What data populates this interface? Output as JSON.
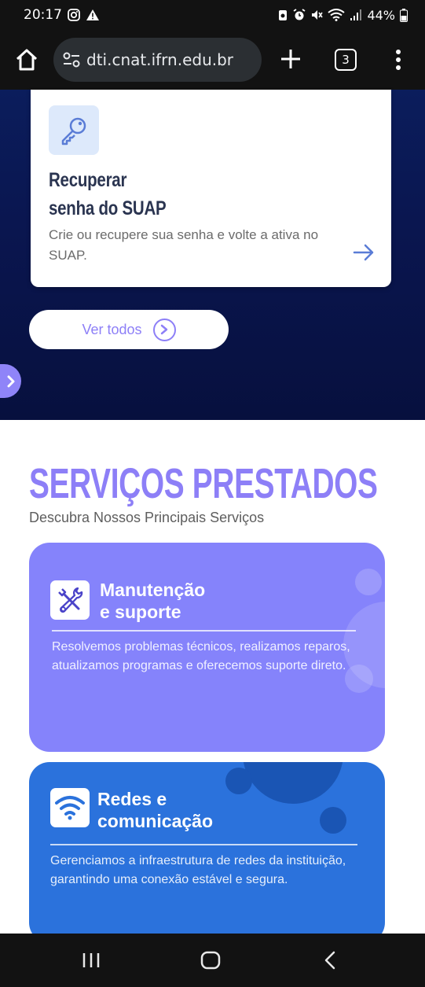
{
  "status": {
    "time": "20:17",
    "battery": "44%"
  },
  "browser": {
    "url": "dti.cnat.ifrn.edu.br",
    "tab_count": "3"
  },
  "recover_card": {
    "title_line1": "Recuperar",
    "title_line2": "senha do SUAP",
    "description": "Crie ou recupere sua senha e volte a ativa no SUAP."
  },
  "see_all_label": "Ver todos",
  "services": {
    "title": "SERVIÇOS PRESTADOS",
    "subtitle": "Descubra Nossos Principais Serviços",
    "items": [
      {
        "title_line1": "Manutenção",
        "title_line2": "e suporte",
        "description": "Resolvemos problemas técnicos, realizamos reparos, atualizamos programas e oferecemos suporte direto."
      },
      {
        "title_line1": "Redes e",
        "title_line2": "comunicação",
        "description": "Gerenciamos a infraestrutura de redes da instituição, garantindo uma conexão estável e segura."
      }
    ]
  },
  "colors": {
    "accent": "#8d7ff7",
    "hero_bg": "#0a1650",
    "card_maint": "#8583fb",
    "card_net": "#2b72dc"
  },
  "icons": [
    "home-icon",
    "site-settings-icon",
    "plus-icon",
    "tabs-icon",
    "more-icon",
    "key-icon",
    "arrow-right-icon",
    "chevron-right-icon",
    "tools-icon",
    "wifi-icon",
    "recents-icon",
    "home-nav-icon",
    "back-icon"
  ]
}
